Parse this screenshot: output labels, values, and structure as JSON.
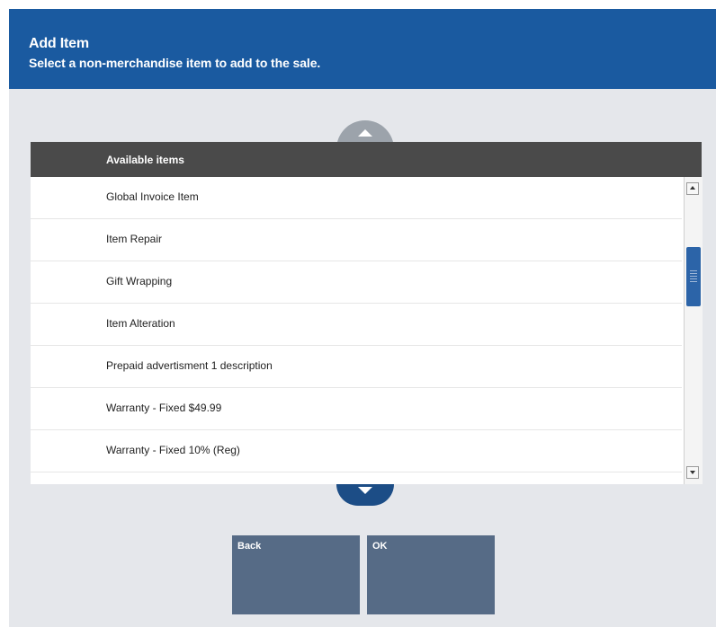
{
  "header": {
    "title": "Add Item",
    "subtitle": "Select a non-merchandise item to add to the sale."
  },
  "list": {
    "header": "Available items",
    "items": [
      {
        "label": "Global Invoice Item"
      },
      {
        "label": "Item Repair"
      },
      {
        "label": "Gift Wrapping"
      },
      {
        "label": "Item Alteration"
      },
      {
        "label": "Prepaid advertisment 1 description"
      },
      {
        "label": "Warranty - Fixed $49.99"
      },
      {
        "label": "Warranty - Fixed 10% (Reg)"
      },
      {
        "label": ""
      }
    ]
  },
  "buttons": {
    "back": "Back",
    "ok": "OK"
  },
  "icons": {
    "scroll_up": "chevron-up-icon",
    "scroll_down": "chevron-down-icon"
  },
  "colors": {
    "header_bg": "#1a5aa0",
    "list_header_bg": "#4a4a4a",
    "button_bg": "#566b86",
    "scroll_down_bg": "#1c4d86",
    "scroll_up_bg": "#9ca3ab",
    "page_bg": "#e5e7eb"
  }
}
